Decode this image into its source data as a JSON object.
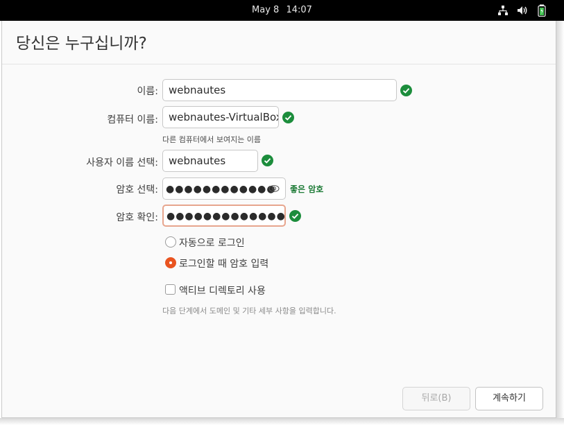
{
  "topbar": {
    "date": "May 8",
    "time": "14:07",
    "tray_icons": [
      "network-icon",
      "volume-icon",
      "battery-icon"
    ]
  },
  "page": {
    "title": "당신은 누구십니까?"
  },
  "form": {
    "name": {
      "label": "이름:",
      "value": "webnautes"
    },
    "computer_name": {
      "label": "컴퓨터 이름:",
      "value": "webnautes-VirtualBox",
      "hint": "다른 컴퓨터에서 보여지는 이름"
    },
    "username": {
      "label": "사용자 이름 선택:",
      "value": "webnautes"
    },
    "password": {
      "label": "암호 선택:",
      "masked": "●●●●●●●●●●●●",
      "strength": "좋은 암호"
    },
    "confirm_password": {
      "label": "암호 확인:",
      "masked": "●●●●●●●●●●●●●●"
    }
  },
  "login_options": {
    "auto_login": {
      "label": "자동으로 로그인",
      "selected": false
    },
    "require_password": {
      "label": "로그인할 때 암호 입력",
      "selected": true
    }
  },
  "active_directory": {
    "label": "액티브 디렉토리 사용",
    "checked": false,
    "note": "다음 단계에서 도메인 및 기타 세부 사항을 입력합니다."
  },
  "buttons": {
    "back": "뒤로(B)",
    "next": "계속하기"
  },
  "colors": {
    "accent": "#e95420",
    "ok": "#1c8d3c"
  }
}
